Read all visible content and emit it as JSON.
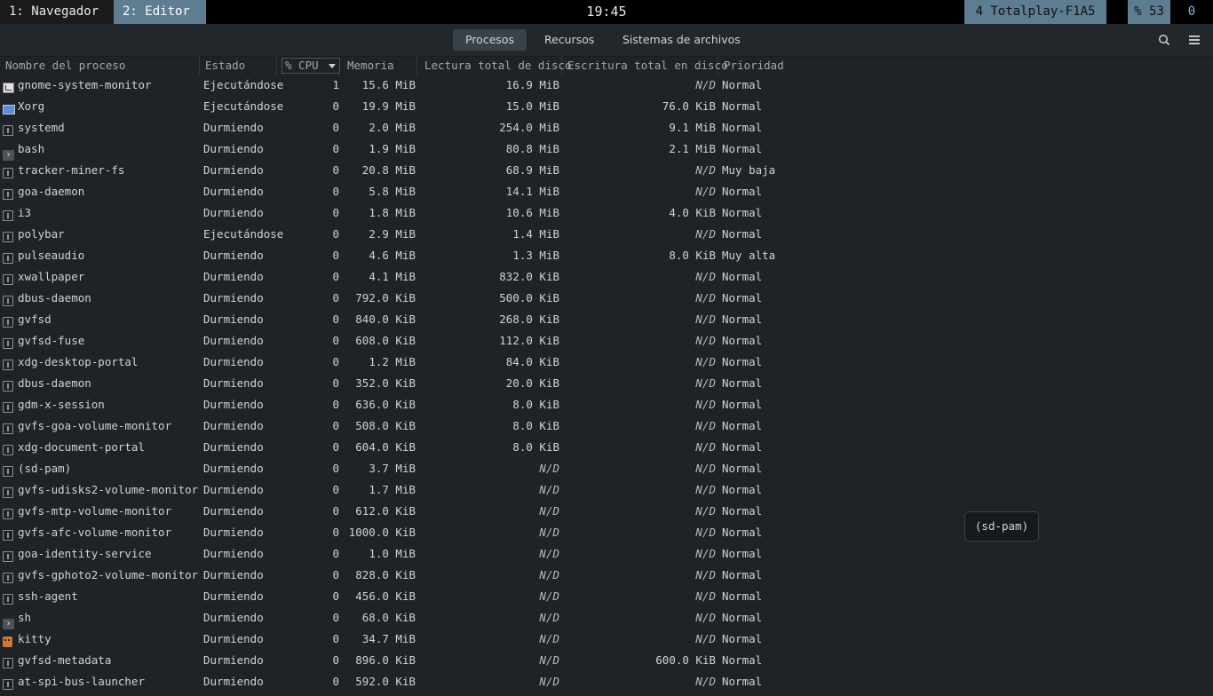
{
  "topbar": {
    "workspaces": [
      "1: Navegador",
      "2: Editor"
    ],
    "clock": "19:45",
    "wifi": "4 Totalplay-F1A5",
    "battery": "% 53",
    "counter": "0"
  },
  "header": {
    "tabs": [
      "Procesos",
      "Recursos",
      "Sistemas de archivos"
    ],
    "active_tab": "Procesos",
    "icons": [
      "search-icon",
      "hamburger-menu-icon"
    ]
  },
  "table": {
    "columns": [
      "Nombre del proceso",
      "Estado",
      "% CPU",
      "Memoria",
      "Lectura total de disco",
      "Escritura total en disco",
      "Prioridad"
    ],
    "sort_column": "% CPU",
    "rows": [
      {
        "icon": "system-monitor-icon",
        "name": "gnome-system-monitor",
        "state": "Ejecutándose",
        "cpu": "1",
        "mem": "15.6 MiB",
        "read": "16.9 MiB",
        "write": "N/D",
        "prio": "Normal"
      },
      {
        "icon": "display-icon",
        "name": "Xorg",
        "state": "Ejecutándose",
        "cpu": "0",
        "mem": "19.9 MiB",
        "read": "15.0 MiB",
        "write": "76.0 KiB",
        "prio": "Normal"
      },
      {
        "icon": "generic-process-icon",
        "name": "systemd",
        "state": "Durmiendo",
        "cpu": "0",
        "mem": "2.0 MiB",
        "read": "254.0 MiB",
        "write": "9.1 MiB",
        "prio": "Normal"
      },
      {
        "icon": "terminal-icon",
        "name": "bash",
        "state": "Durmiendo",
        "cpu": "0",
        "mem": "1.9 MiB",
        "read": "80.8 MiB",
        "write": "2.1 MiB",
        "prio": "Normal"
      },
      {
        "icon": "generic-process-icon",
        "name": "tracker-miner-fs",
        "state": "Durmiendo",
        "cpu": "0",
        "mem": "20.8 MiB",
        "read": "68.9 MiB",
        "write": "N/D",
        "prio": "Muy baja"
      },
      {
        "icon": "generic-process-icon",
        "name": "goa-daemon",
        "state": "Durmiendo",
        "cpu": "0",
        "mem": "5.8 MiB",
        "read": "14.1 MiB",
        "write": "N/D",
        "prio": "Normal"
      },
      {
        "icon": "generic-process-icon",
        "name": "i3",
        "state": "Durmiendo",
        "cpu": "0",
        "mem": "1.8 MiB",
        "read": "10.6 MiB",
        "write": "4.0 KiB",
        "prio": "Normal"
      },
      {
        "icon": "generic-process-icon",
        "name": "polybar",
        "state": "Ejecutándose",
        "cpu": "0",
        "mem": "2.9 MiB",
        "read": "1.4 MiB",
        "write": "N/D",
        "prio": "Normal"
      },
      {
        "icon": "generic-process-icon",
        "name": "pulseaudio",
        "state": "Durmiendo",
        "cpu": "0",
        "mem": "4.6 MiB",
        "read": "1.3 MiB",
        "write": "8.0 KiB",
        "prio": "Muy alta"
      },
      {
        "icon": "generic-process-icon",
        "name": "xwallpaper",
        "state": "Durmiendo",
        "cpu": "0",
        "mem": "4.1 MiB",
        "read": "832.0 KiB",
        "write": "N/D",
        "prio": "Normal"
      },
      {
        "icon": "generic-process-icon",
        "name": "dbus-daemon",
        "state": "Durmiendo",
        "cpu": "0",
        "mem": "792.0 KiB",
        "read": "500.0 KiB",
        "write": "N/D",
        "prio": "Normal"
      },
      {
        "icon": "generic-process-icon",
        "name": "gvfsd",
        "state": "Durmiendo",
        "cpu": "0",
        "mem": "840.0 KiB",
        "read": "268.0 KiB",
        "write": "N/D",
        "prio": "Normal"
      },
      {
        "icon": "generic-process-icon",
        "name": "gvfsd-fuse",
        "state": "Durmiendo",
        "cpu": "0",
        "mem": "608.0 KiB",
        "read": "112.0 KiB",
        "write": "N/D",
        "prio": "Normal"
      },
      {
        "icon": "generic-process-icon",
        "name": "xdg-desktop-portal",
        "state": "Durmiendo",
        "cpu": "0",
        "mem": "1.2 MiB",
        "read": "84.0 KiB",
        "write": "N/D",
        "prio": "Normal"
      },
      {
        "icon": "generic-process-icon",
        "name": "dbus-daemon",
        "state": "Durmiendo",
        "cpu": "0",
        "mem": "352.0 KiB",
        "read": "20.0 KiB",
        "write": "N/D",
        "prio": "Normal"
      },
      {
        "icon": "generic-process-icon",
        "name": "gdm-x-session",
        "state": "Durmiendo",
        "cpu": "0",
        "mem": "636.0 KiB",
        "read": "8.0 KiB",
        "write": "N/D",
        "prio": "Normal"
      },
      {
        "icon": "generic-process-icon",
        "name": "gvfs-goa-volume-monitor",
        "state": "Durmiendo",
        "cpu": "0",
        "mem": "508.0 KiB",
        "read": "8.0 KiB",
        "write": "N/D",
        "prio": "Normal"
      },
      {
        "icon": "generic-process-icon",
        "name": "xdg-document-portal",
        "state": "Durmiendo",
        "cpu": "0",
        "mem": "604.0 KiB",
        "read": "8.0 KiB",
        "write": "N/D",
        "prio": "Normal"
      },
      {
        "icon": "generic-process-icon",
        "name": "(sd-pam)",
        "state": "Durmiendo",
        "cpu": "0",
        "mem": "3.7 MiB",
        "read": "N/D",
        "write": "N/D",
        "prio": "Normal"
      },
      {
        "icon": "generic-process-icon",
        "name": "gvfs-udisks2-volume-monitor",
        "state": "Durmiendo",
        "cpu": "0",
        "mem": "1.7 MiB",
        "read": "N/D",
        "write": "N/D",
        "prio": "Normal"
      },
      {
        "icon": "generic-process-icon",
        "name": "gvfs-mtp-volume-monitor",
        "state": "Durmiendo",
        "cpu": "0",
        "mem": "612.0 KiB",
        "read": "N/D",
        "write": "N/D",
        "prio": "Normal"
      },
      {
        "icon": "generic-process-icon",
        "name": "gvfs-afc-volume-monitor",
        "state": "Durmiendo",
        "cpu": "0",
        "mem": "1000.0 KiB",
        "read": "N/D",
        "write": "N/D",
        "prio": "Normal"
      },
      {
        "icon": "generic-process-icon",
        "name": "goa-identity-service",
        "state": "Durmiendo",
        "cpu": "0",
        "mem": "1.0 MiB",
        "read": "N/D",
        "write": "N/D",
        "prio": "Normal"
      },
      {
        "icon": "generic-process-icon",
        "name": "gvfs-gphoto2-volume-monitor",
        "state": "Durmiendo",
        "cpu": "0",
        "mem": "828.0 KiB",
        "read": "N/D",
        "write": "N/D",
        "prio": "Normal"
      },
      {
        "icon": "generic-process-icon",
        "name": "ssh-agent",
        "state": "Durmiendo",
        "cpu": "0",
        "mem": "456.0 KiB",
        "read": "N/D",
        "write": "N/D",
        "prio": "Normal"
      },
      {
        "icon": "terminal-icon",
        "name": "sh",
        "state": "Durmiendo",
        "cpu": "0",
        "mem": "68.0 KiB",
        "read": "N/D",
        "write": "N/D",
        "prio": "Normal"
      },
      {
        "icon": "kitty-icon",
        "name": "kitty",
        "state": "Durmiendo",
        "cpu": "0",
        "mem": "34.7 MiB",
        "read": "N/D",
        "write": "N/D",
        "prio": "Normal"
      },
      {
        "icon": "generic-process-icon",
        "name": "gvfsd-metadata",
        "state": "Durmiendo",
        "cpu": "0",
        "mem": "896.0 KiB",
        "read": "N/D",
        "write": "600.0 KiB",
        "prio": "Normal"
      },
      {
        "icon": "generic-process-icon",
        "name": "at-spi-bus-launcher",
        "state": "Durmiendo",
        "cpu": "0",
        "mem": "592.0 KiB",
        "read": "N/D",
        "write": "N/D",
        "prio": "Normal"
      }
    ]
  },
  "tooltip": "(sd-pam)"
}
